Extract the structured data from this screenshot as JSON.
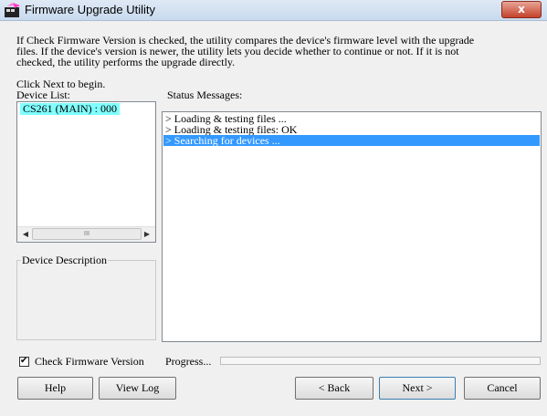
{
  "window": {
    "title": "Firmware Upgrade Utility",
    "close_label": "x"
  },
  "info": {
    "text": "If Check Firmware Version is checked, the utility compares the device's firmware level with the upgrade\nfiles. If the device's version is newer, the utility lets you decide whether to continue or not. If it is not\nchecked, the utility performs the upgrade directly.",
    "click_next": "Click Next to begin."
  },
  "device_list": {
    "label": "Device List:",
    "items": [
      {
        "text": "CS261 (MAIN) : 000",
        "selected": true
      }
    ],
    "scroll": {
      "left_icon": "◀",
      "thumb_grip": "III",
      "right_icon": "▶"
    }
  },
  "device_description": {
    "label": "Device Description"
  },
  "status": {
    "label": "Status Messages:",
    "messages": [
      {
        "text": "> Loading & testing files ...",
        "selected": false
      },
      {
        "text": "> Loading & testing files: OK",
        "selected": false
      },
      {
        "text": "> Searching for devices ...",
        "selected": true
      }
    ]
  },
  "options": {
    "check_firmware_label": "Check Firmware Version",
    "check_firmware_checked": true,
    "check_mark": "✔",
    "progress_label": "Progress..."
  },
  "buttons": {
    "help": "Help",
    "view_log": "View Log",
    "back": "< Back",
    "next": "Next >",
    "cancel": "Cancel"
  },
  "colors": {
    "selection_cyan": "#80ffff",
    "selection_blue": "#3399ff",
    "close_red": "#c4412c"
  }
}
